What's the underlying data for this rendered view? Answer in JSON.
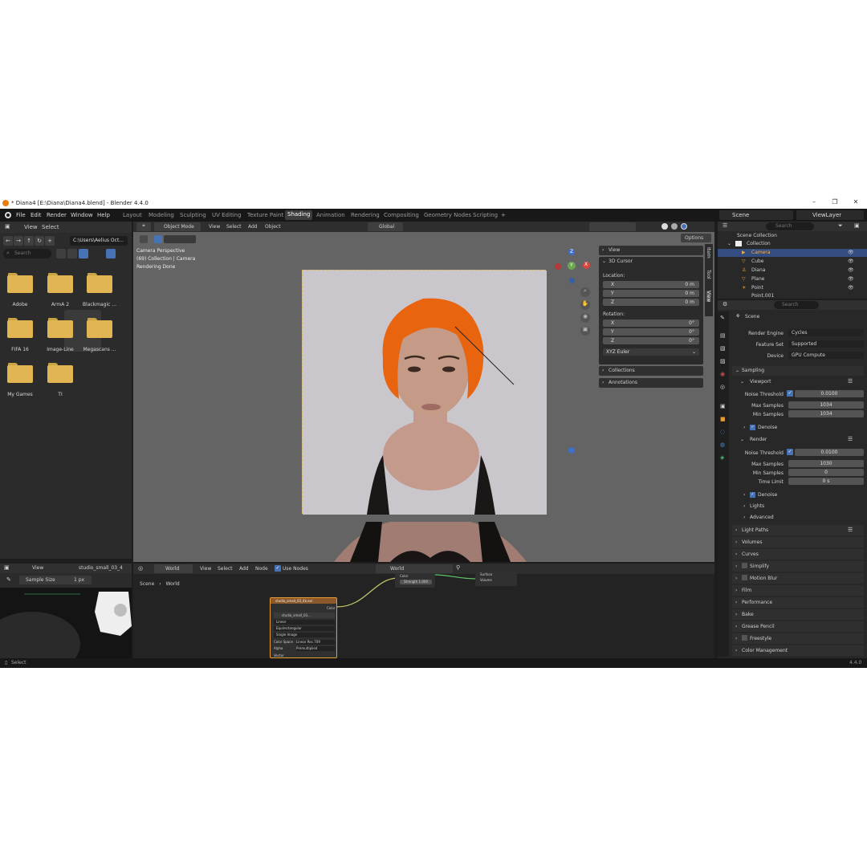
{
  "window": {
    "title": "* Diana4 [E:\\Diana\\Diana4.blend] - Blender 4.4.0"
  },
  "menu": {
    "file": "File",
    "edit": "Edit",
    "render": "Render",
    "window": "Window",
    "help": "Help"
  },
  "workspaces": [
    "Layout",
    "Modeling",
    "Sculpting",
    "UV Editing",
    "Texture Paint",
    "Shading",
    "Animation",
    "Rendering",
    "Compositing",
    "Geometry Nodes",
    "Scripting"
  ],
  "workspace_active": "Shading",
  "file_browser": {
    "menu_view": "View",
    "menu_select": "Select",
    "path": "C:\\Users\\Aelius Oct...",
    "search_placeholder": "Search",
    "folders": [
      "Adobe",
      "ArmA 2",
      "Blackmagic ...",
      "FIFA 16",
      "Image-Line",
      "Megascans ...",
      "My Games",
      "TI"
    ]
  },
  "viewport": {
    "mode": "Object Mode",
    "view": "View",
    "select": "Select",
    "add": "Add",
    "object": "Object",
    "orientation": "Global",
    "options": "Options",
    "overlay_line1": "Camera Perspective",
    "overlay_line2": "(69) Collection | Camera",
    "overlay_line3": "Rendering Done",
    "gizmo_z": "Z",
    "gizmo_x": "X",
    "gizmo_y": "Y",
    "side_tabs": [
      "Item",
      "Tool",
      "View"
    ]
  },
  "n_panel": {
    "view": "View",
    "cursor": "3D Cursor",
    "location": "Location:",
    "loc_x": "X",
    "loc_y": "Y",
    "loc_z": "Z",
    "loc_x_val": "0 m",
    "loc_y_val": "0 m",
    "loc_z_val": "0 m",
    "rotation": "Rotation:",
    "rot_x_val": "0°",
    "rot_y_val": "0°",
    "rot_z_val": "0°",
    "rot_mode": "XYZ Euler",
    "collections": "Collections",
    "annotations": "Annotations"
  },
  "image_editor": {
    "view": "View",
    "image_name": "studio_small_03_4",
    "sample_label": "Sample Size",
    "sample_value": "1 px"
  },
  "node_editor": {
    "type": "World",
    "view": "View",
    "select": "Select",
    "add": "Add",
    "node": "Node",
    "use_nodes": "Use Nodes",
    "world_name": "World",
    "breadcrumb_scene": "Scene",
    "breadcrumb_world": "World",
    "bg_color": "Color",
    "bg_strength": "Strength  1.000",
    "out_surface": "Surface",
    "out_volume": "Volume",
    "env_title": "studio_small_03_4k.exr",
    "env_out": "Color",
    "env_image": "studio_small_03...",
    "env_rows": [
      "Linear",
      "Equirectangular",
      "Single Image"
    ],
    "env_cs_label": "Color Space",
    "env_cs_value": "Linear Rec.709",
    "env_alpha_label": "Alpha",
    "env_alpha_value": "Premultiplied",
    "env_vector": "Vector"
  },
  "outliner": {
    "scene": "Scene",
    "view_layer": "ViewLayer",
    "search_placeholder": "Search",
    "root": "Scene Collection",
    "collection": "Collection",
    "items": [
      "Camera",
      "Cube",
      "Diana",
      "Plane",
      "Point",
      "Point.001"
    ]
  },
  "properties": {
    "search_placeholder": "Search",
    "scene": "Scene",
    "render_engine_label": "Render Engine",
    "render_engine": "Cycles",
    "feature_set_label": "Feature Set",
    "feature_set": "Supported",
    "device_label": "Device",
    "device": "GPU Compute",
    "sampling": "Sampling",
    "viewport": "Viewport",
    "noise_threshold": "Noise Threshold",
    "vp_noise": "0.0100",
    "max_samples": "Max Samples",
    "vp_max": "1034",
    "min_samples": "Min Samples",
    "vp_min": "1034",
    "denoise": "Denoise",
    "render": "Render",
    "r_noise": "0.0100",
    "r_max": "1030",
    "r_min": "0",
    "time_limit": "Time Limit",
    "r_time": "0 s",
    "lights": "Lights",
    "advanced": "Advanced",
    "sections": [
      "Light Paths",
      "Volumes",
      "Curves",
      "Simplify",
      "Motion Blur",
      "Film",
      "Performance",
      "Bake",
      "Grease Pencil",
      "Freestyle",
      "Color Management"
    ]
  },
  "status": {
    "select": "Select",
    "version": "4.4.0"
  }
}
